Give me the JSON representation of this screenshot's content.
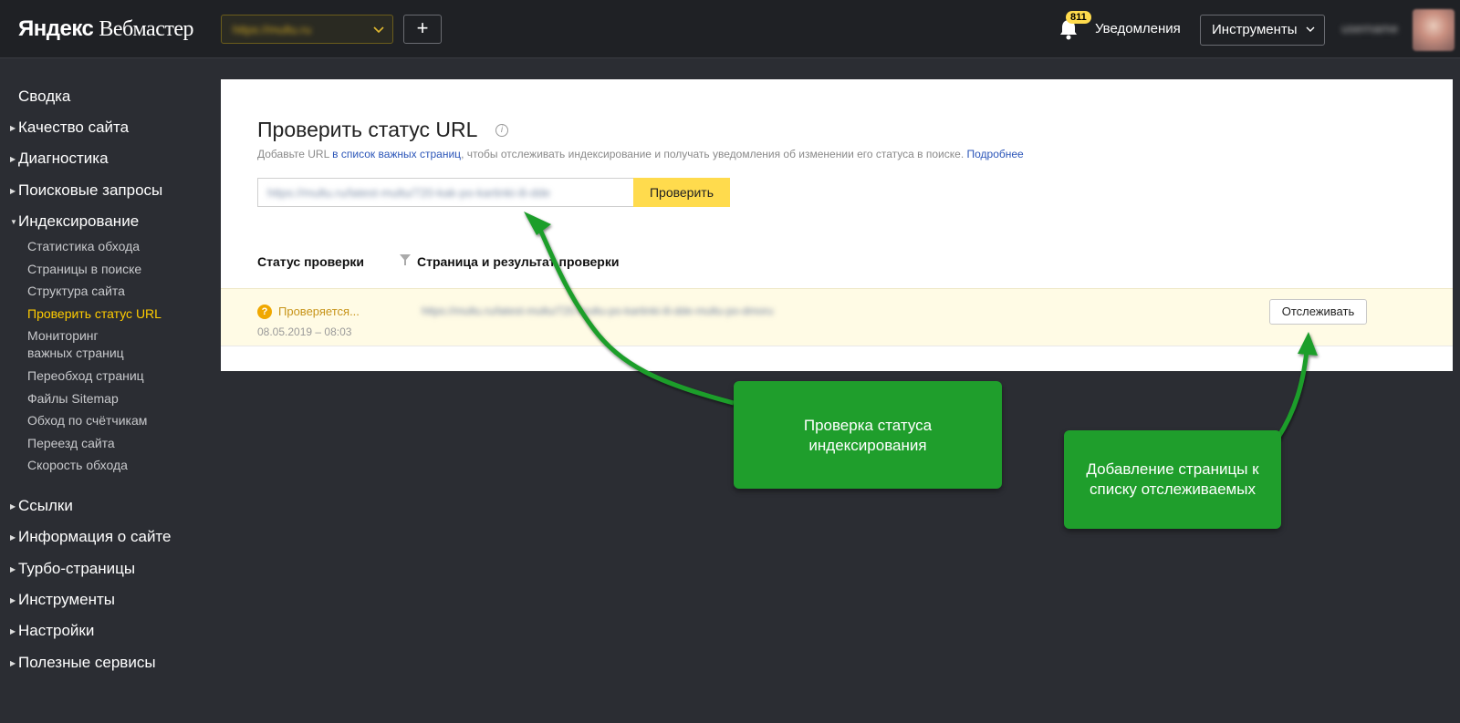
{
  "header": {
    "logo_brand": "Яндекс",
    "logo_product": "Вебмастер",
    "site_select_value": "https://multu.ru",
    "add_label": "+",
    "notifications_count": "811",
    "notifications_label": "Уведомления",
    "tools_label": "Инструменты",
    "tools_chevron": "⌵",
    "user_name": "username"
  },
  "sidebar": {
    "summary": "Сводка",
    "quality": "Качество сайта",
    "diagnostics": "Диагностика",
    "search_queries": "Поисковые запросы",
    "indexing": "Индексирование",
    "indexing_items": [
      "Статистика обхода",
      "Страницы в поиске",
      "Структура сайта",
      "Проверить статус URL",
      "Мониторинг",
      "важных страниц",
      "Переобход страниц",
      "Файлы Sitemap",
      "Обход по счётчикам",
      "Переезд сайта",
      "Скорость обхода"
    ],
    "links": "Ссылки",
    "site_info": "Информация о сайте",
    "turbo": "Турбо-страницы",
    "tools": "Инструменты",
    "settings": "Настройки",
    "useful": "Полезные сервисы"
  },
  "main": {
    "title": "Проверить статус URL",
    "subtitle_pre": "Добавьте URL ",
    "subtitle_link": "в список важных страниц",
    "subtitle_post": ", чтобы отслеживать индексирование и получать уведомления об изменении его статуса в поиске. ",
    "subtitle_more": "Подробнее",
    "url_value": "https://multu.ru/latest-multu/720-kak-po-kartinki-ili-dde",
    "check_label": "Проверить",
    "col_status": "Статус проверки",
    "col_page": "Страница и результат проверки",
    "row": {
      "status": "Проверяется...",
      "date": "08.05.2019 – 08:03",
      "url": "https://multu.ru/latest-multu/720-multu-po-kartinki-ili-dde-multu-po-dmoru",
      "track_label": "Отслеживать"
    }
  },
  "callouts": {
    "first_line1": "Проверка статуса",
    "first_line2": "индексирования",
    "second_line1": "Добавление страницы к",
    "second_line2": "списку отслеживаемых"
  },
  "colors": {
    "accent_yellow": "#ffdb4d",
    "active_nav": "#ffcc00",
    "callout_green": "#1f9e2c"
  }
}
